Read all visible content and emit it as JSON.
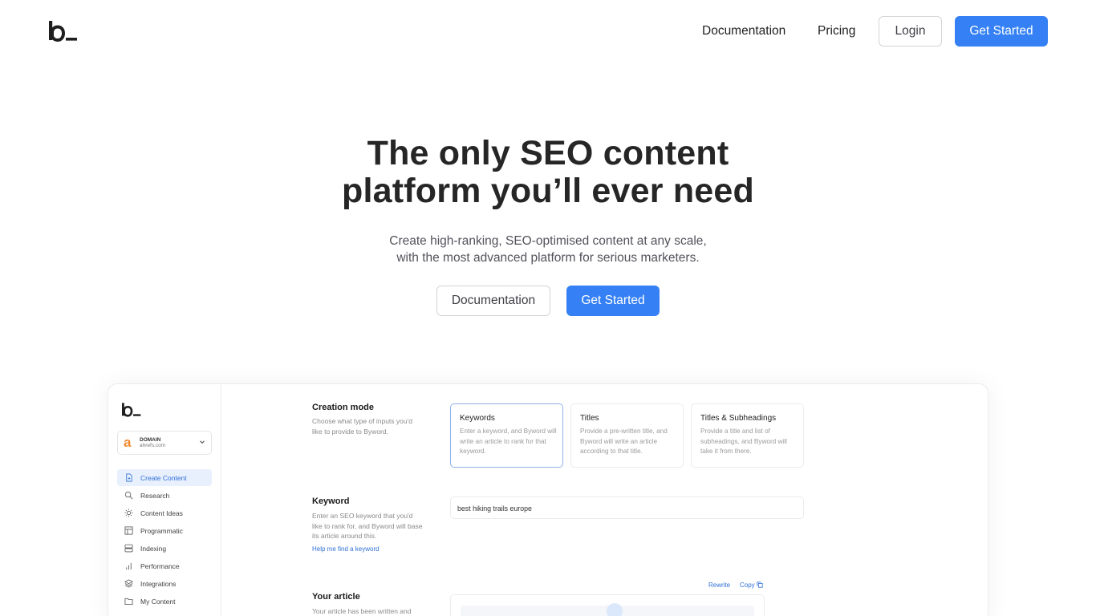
{
  "colors": {
    "accent": "#3480f4",
    "text": "#262626",
    "muted": "#52525b",
    "ahrefs_orange": "#f28a2e"
  },
  "nav": {
    "logo_icon": "byword-logo",
    "links": [
      "Documentation",
      "Pricing"
    ],
    "login_label": "Login",
    "cta_label": "Get Started"
  },
  "hero": {
    "title_line1": "The only SEO content",
    "title_line2": "platform you’ll ever need",
    "subtitle_line1": "Create high-ranking, SEO-optimised content at any scale,",
    "subtitle_line2": "with the most advanced platform for serious marketers.",
    "secondary_button": "Documentation",
    "primary_button": "Get Started"
  },
  "preview": {
    "domain": {
      "label": "DOMAIN",
      "value": "ahrefs.com",
      "logo_letter": "a"
    },
    "sidebar": [
      {
        "label": "Create Content",
        "icon": "file-plus-icon"
      },
      {
        "label": "Research",
        "icon": "search-icon"
      },
      {
        "label": "Content Ideas",
        "icon": "sun-icon"
      },
      {
        "label": "Programmatic",
        "icon": "table-icon"
      },
      {
        "label": "Indexing",
        "icon": "stack-icon"
      },
      {
        "label": "Performance",
        "icon": "bar-chart-icon"
      },
      {
        "label": "Integrations",
        "icon": "layers-icon"
      },
      {
        "label": "My Content",
        "icon": "folder-icon"
      }
    ],
    "creation_mode": {
      "title": "Creation mode",
      "description": "Choose what type of inputs you'd like to provide to Byword.",
      "cards": [
        {
          "title": "Keywords",
          "description": "Enter a keyword, and Byword will write an article to rank for that keyword."
        },
        {
          "title": "Titles",
          "description": "Provide a pre-written title, and Byword will write an article according to that title."
        },
        {
          "title": "Titles & Subheadings",
          "description": "Provide a title and list of subheadings, and Byword will take it from there."
        }
      ]
    },
    "keyword": {
      "title": "Keyword",
      "description": "Enter an SEO keyword that you'd like to rank for, and Byword will base its article around this.",
      "help_link": "Help me find a keyword",
      "value": "best hiking trails europe"
    },
    "article": {
      "title": "Your article",
      "description": "Your article has been written and",
      "rewrite_label": "Rewrite",
      "copy_label": "Copy"
    }
  }
}
